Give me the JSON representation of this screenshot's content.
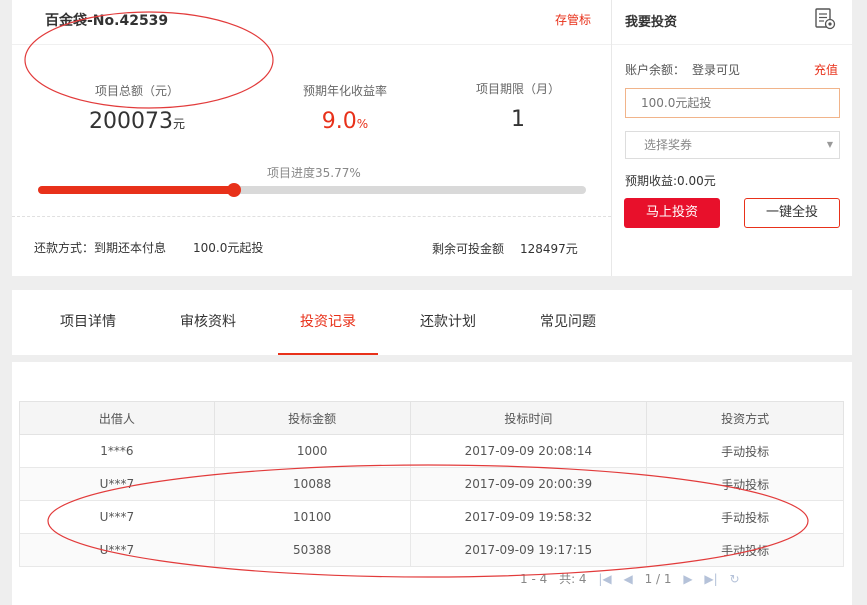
{
  "project": {
    "title": "百金袋-No.42539",
    "custody_label": "存管标",
    "stats": [
      {
        "label": "项目总额（元）",
        "value": "200073",
        "unit": "元"
      },
      {
        "label": "预期年化收益率",
        "value": "9.0",
        "unit": "%"
      },
      {
        "label": "项目期限（月）",
        "value": "1",
        "unit": ""
      }
    ],
    "progress_label": "项目进度35.77%",
    "progress_fraction": 0.3577,
    "repay_method": "还款方式：到期还本付息",
    "min_bid": "100.0元起投",
    "remain_label": "剩余可投金额",
    "remain_value": "128497元"
  },
  "invest": {
    "title": "我要投资",
    "balance_label": "账户余额：",
    "balance_value": "登录可见",
    "recharge": "充值",
    "amount_placeholder": "100.0元起投",
    "coupon_placeholder": "选择奖券",
    "expected": "预期收益:0.00元",
    "invest_button": "马上投资",
    "invest_all_button": "一键全投"
  },
  "tabs": [
    {
      "label": "项目详情"
    },
    {
      "label": "审核资料"
    },
    {
      "label": "投资记录"
    },
    {
      "label": "还款计划"
    },
    {
      "label": "常见问题"
    }
  ],
  "records": {
    "headers": [
      "出借人",
      "投标金额",
      "投标时间",
      "投资方式"
    ],
    "rows": [
      [
        "1***6",
        "1000",
        "2017-09-09 20:08:14",
        "手动投标"
      ],
      [
        "U***7",
        "10088",
        "2017-09-09 20:00:39",
        "手动投标"
      ],
      [
        "U***7",
        "10100",
        "2017-09-09 19:58:32",
        "手动投标"
      ],
      [
        "U***7",
        "50388",
        "2017-09-09 19:17:15",
        "手动投标"
      ]
    ]
  },
  "pager": {
    "range": "1 - 4",
    "total": "共: 4",
    "page": "1 / 1"
  },
  "colors": {
    "accent": "#e8311a",
    "button_red": "#e8102b"
  }
}
